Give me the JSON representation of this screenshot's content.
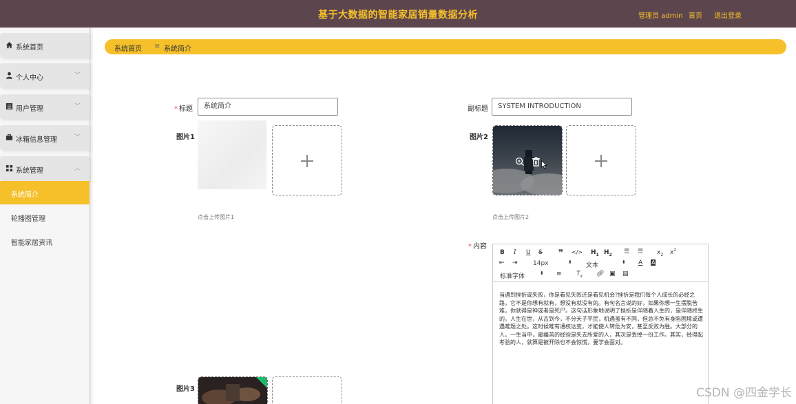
{
  "header": {
    "title": "基于大数据的智能家居销量数据分析",
    "admin_label": "管理员 admin",
    "home_label": "首页",
    "logout_label": "退出登录"
  },
  "sidebar": {
    "items": [
      {
        "label": "系统首页"
      },
      {
        "label": "个人中心"
      },
      {
        "label": "用户管理"
      },
      {
        "label": "冰箱信息管理"
      },
      {
        "label": "系统管理"
      }
    ],
    "submenu": [
      {
        "label": "系统简介",
        "active": true
      },
      {
        "label": "轮播图管理"
      },
      {
        "label": "智能家居资讯"
      }
    ]
  },
  "breadcrumb": {
    "home": "系统首页",
    "separator": "≡",
    "current": "系统简介"
  },
  "form": {
    "title_label": "标题",
    "title_value": "系统简介",
    "subtitle_label": "副标题",
    "subtitle_value": "SYSTEM INTRODUCTION",
    "image1_label": "图片1",
    "image1_hint": "点击上传图片1",
    "image2_label": "图片2",
    "image2_hint": "点击上传图片2",
    "image3_label": "图片3",
    "content_label": "内容"
  },
  "editor": {
    "font_size": "14px",
    "text_type": "文本",
    "font_family": "标准字体",
    "content": "当遇到挫折或失败，你是看见失败还是看见机会?挫折是我们每个人成长的必经之路，它不是你想有就有，想没有就没有的。有句名言说的好，如果你想一生摆脱苦难，你就得是神或者是死尸。这句话形象地说明了挫折是伴随着人生的，是伴随终生的。人生在世，从古到今，不分天子平民，机遇虽有不同，但总不免有身陷困境或遭遇难题之处。这时候唯有通权达变，才能使人转危为安，甚至反败为胜。大部分的人，一生当中，最痛苦的经验是失去所爱的人，其次是丢掉一份工作。其实，经得起考验的人，就算是被开除也不会惊慌，要学会面对。"
  },
  "watermark": "CSDN @四金学长",
  "colors": {
    "header_bg": "#5d454d",
    "accent": "#f5c02a"
  }
}
